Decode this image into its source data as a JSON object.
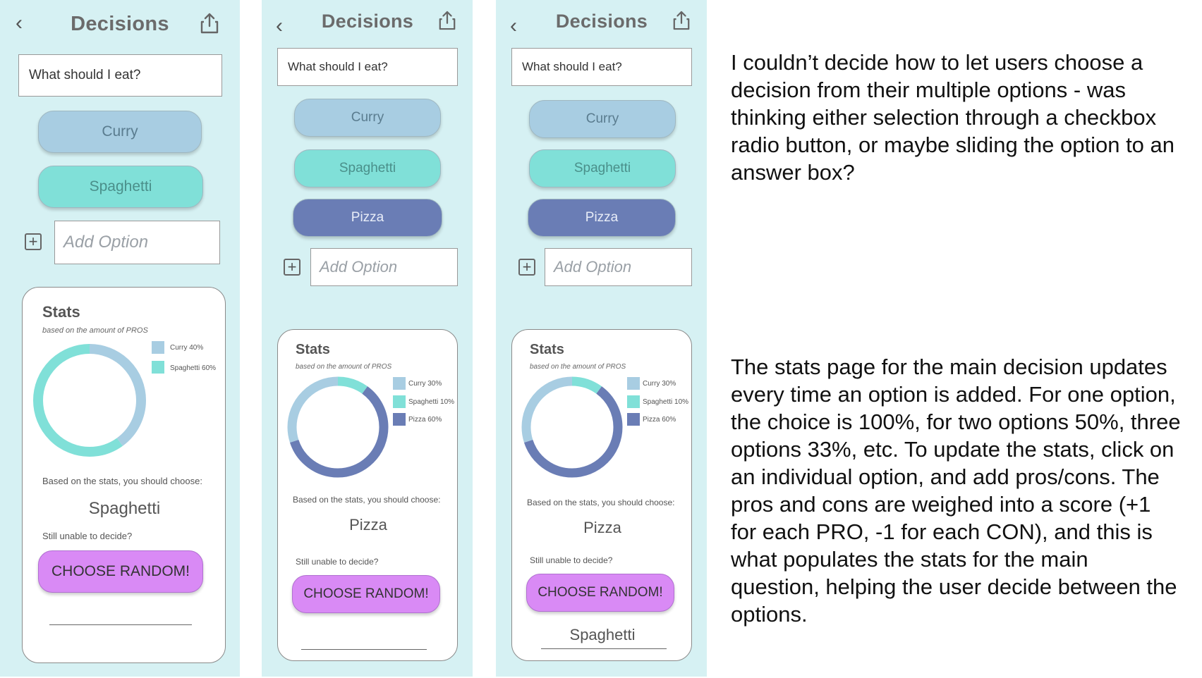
{
  "app": {
    "title": "Decisions",
    "back_glyph": "‹",
    "share_icon": "share-icon"
  },
  "screens": [
    {
      "question": "What should I eat?",
      "options": [
        "Curry",
        "Spaghetti"
      ],
      "add_option_placeholder": "Add Option",
      "stats": {
        "title": "Stats",
        "subtitle": "based on the amount of PROS",
        "legend": [
          "Curry 40%",
          "Spaghetti 60%"
        ],
        "based_on": "Based on the stats, you should choose:",
        "result": "Spaghetti",
        "unable": "Still unable to decide?",
        "random_button": "CHOOSE RANDOM!",
        "random_result": ""
      }
    },
    {
      "question": "What should I eat?",
      "options": [
        "Curry",
        "Spaghetti",
        "Pizza"
      ],
      "add_option_placeholder": "Add Option",
      "stats": {
        "title": "Stats",
        "subtitle": "based on the amount of PROS",
        "legend": [
          "Curry 30%",
          "Spaghetti 10%",
          "Pizza 60%"
        ],
        "based_on": "Based on the stats, you should choose:",
        "result": "Pizza",
        "unable": "Still unable to decide?",
        "random_button": "CHOOSE RANDOM!",
        "random_result": ""
      }
    },
    {
      "question": "What should I eat?",
      "options": [
        "Curry",
        "Spaghetti",
        "Pizza"
      ],
      "add_option_placeholder": "Add Option",
      "stats": {
        "title": "Stats",
        "subtitle": "based on the amount of PROS",
        "legend": [
          "Curry 30%",
          "Spaghetti 10%",
          "Pizza 60%"
        ],
        "based_on": "Based on the stats, you should choose:",
        "result": "Pizza",
        "unable": "Still unable to decide?",
        "random_button": "CHOOSE RANDOM!",
        "random_result": "Spaghetti"
      }
    }
  ],
  "colors": {
    "curry": "#a8cde2",
    "spaghetti": "#80e0d8",
    "pizza": "#6a7db5",
    "random": "#d98af5",
    "phone_bg": "#d6f1f3"
  },
  "chart_data": [
    {
      "type": "pie",
      "categories": [
        "Curry",
        "Spaghetti"
      ],
      "values": [
        40,
        60
      ],
      "donut": true
    },
    {
      "type": "pie",
      "categories": [
        "Curry",
        "Spaghetti",
        "Pizza"
      ],
      "values": [
        30,
        10,
        60
      ],
      "donut": true
    },
    {
      "type": "pie",
      "categories": [
        "Curry",
        "Spaghetti",
        "Pizza"
      ],
      "values": [
        30,
        10,
        60
      ],
      "donut": true
    }
  ],
  "notes": {
    "top": "I couldn’t decide how to let users choose a decision from their multiple options - was thinking either selection through a checkbox radio button, or maybe sliding the option to an answer box?",
    "bottom": "The stats page for the main decision updates every time an option is added. For one option, the choice is 100%, for two options 50%, three options 33%, etc. To update the stats, click on an individual option, and add pros/cons. The pros and cons are weighed into a score (+1 for each PRO, -1 for each CON), and this is what populates the stats for the main question, helping the user decide between the options."
  }
}
